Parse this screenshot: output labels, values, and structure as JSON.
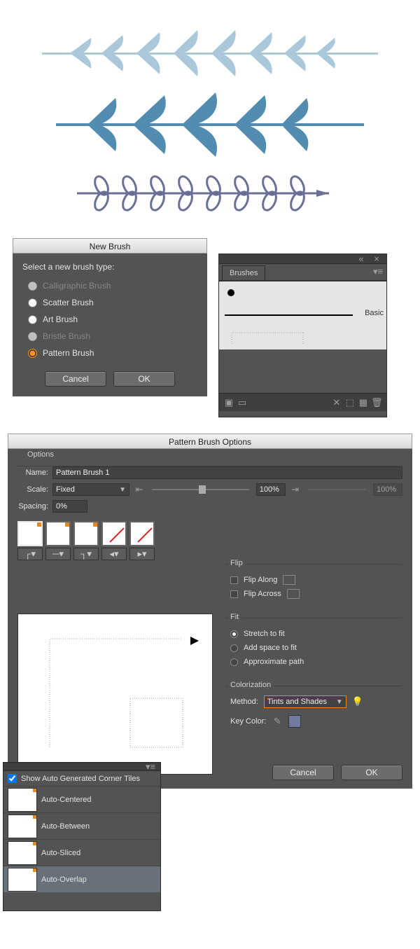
{
  "artwork": {
    "alt": "three floral divider brush strokes (light blue, mid blue, purple looped)"
  },
  "newBrush": {
    "title": "New Brush",
    "prompt": "Select a new brush type:",
    "options": {
      "calligraphic": "Calligraphic Brush",
      "scatter": "Scatter Brush",
      "art": "Art Brush",
      "bristle": "Bristle Brush",
      "pattern": "Pattern Brush"
    },
    "selected": "pattern",
    "cancel": "Cancel",
    "ok": "OK"
  },
  "brushesPanel": {
    "tab": "Brushes",
    "basic": "Basic"
  },
  "pbo": {
    "title": "Pattern Brush Options",
    "sections": {
      "options": "Options",
      "flip": "Flip",
      "fit": "Fit",
      "colorization": "Colorization"
    },
    "name_label": "Name:",
    "name_value": "Pattern Brush 1",
    "scale_label": "Scale:",
    "scale_mode": "Fixed",
    "scale_pct": "100%",
    "scale_pct2": "100%",
    "spacing_label": "Spacing:",
    "spacing_value": "0%",
    "flip_along": "Flip Along",
    "flip_across": "Flip Across",
    "fit_stretch": "Stretch to fit",
    "fit_space": "Add space to fit",
    "fit_approx": "Approximate path",
    "fit_selected": "stretch",
    "method_label": "Method:",
    "method_value": "Tints and Shades",
    "key_color": "Key Color:",
    "cancel": "Cancel",
    "ok": "OK"
  },
  "cornerPopup": {
    "show_label": "Show Auto Generated Corner Tiles",
    "items": [
      "Auto-Centered",
      "Auto-Between",
      "Auto-Sliced",
      "Auto-Overlap"
    ],
    "selected": 3
  }
}
